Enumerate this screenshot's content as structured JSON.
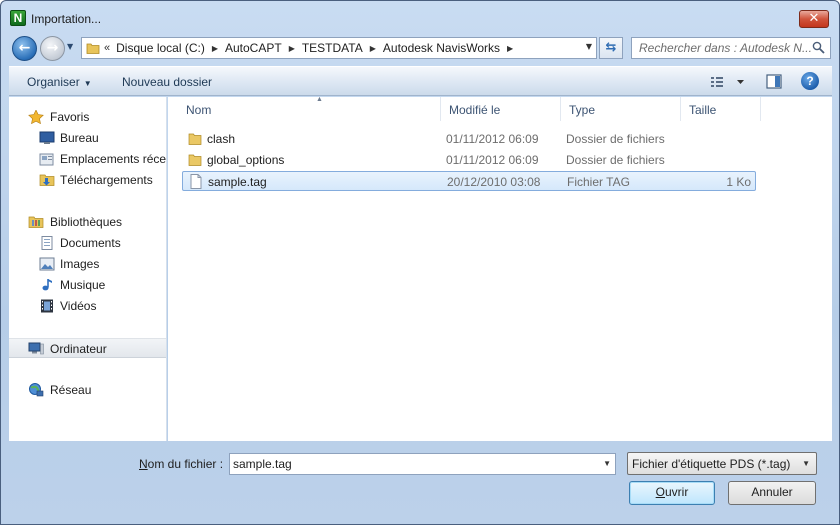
{
  "window": {
    "title": "Importation...",
    "app_icon_letter": "N",
    "close_glyph": "✕"
  },
  "address": {
    "lead": "«",
    "crumbs": [
      "Disque local (C:)",
      "AutoCAPT",
      "TESTDATA",
      "Autodesk NavisWorks"
    ],
    "search_placeholder": "Rechercher dans : Autodesk N..."
  },
  "toolbar": {
    "organise_label": "Organiser",
    "new_folder_label": "Nouveau dossier",
    "help_glyph": "?"
  },
  "sidebar": {
    "favorites": {
      "label": "Favoris",
      "items": [
        "Bureau",
        "Emplacements récents",
        "Téléchargements"
      ]
    },
    "libraries": {
      "label": "Bibliothèques",
      "items": [
        "Documents",
        "Images",
        "Musique",
        "Vidéos"
      ]
    },
    "computer": {
      "label": "Ordinateur"
    },
    "network": {
      "label": "Réseau"
    }
  },
  "columns": {
    "name": "Nom",
    "modified": "Modifié le",
    "type": "Type",
    "size": "Taille"
  },
  "files": [
    {
      "name": "clash",
      "modified": "01/11/2012 06:09",
      "type": "Dossier de fichiers",
      "size": "",
      "kind": "folder-icon"
    },
    {
      "name": "global_options",
      "modified": "01/11/2012 06:09",
      "type": "Dossier de fichiers",
      "size": "",
      "kind": "folder-icon"
    },
    {
      "name": "sample.tag",
      "modified": "20/12/2010 03:08",
      "type": "Fichier TAG",
      "size": "1 Ko",
      "kind": "file-icon",
      "selected": true
    }
  ],
  "footer": {
    "filename_label_accel": "N",
    "filename_label_rest": "om du fichier :",
    "filename_value": "sample.tag",
    "filter_value": "Fichier d'étiquette PDS (*.tag)",
    "open_accel": "O",
    "open_rest": "uvrir",
    "cancel_label": "Annuler"
  },
  "colors": {
    "selection": "#d5e8fb",
    "selection_border": "#84acdd",
    "chrome": "#c9dcf2"
  }
}
